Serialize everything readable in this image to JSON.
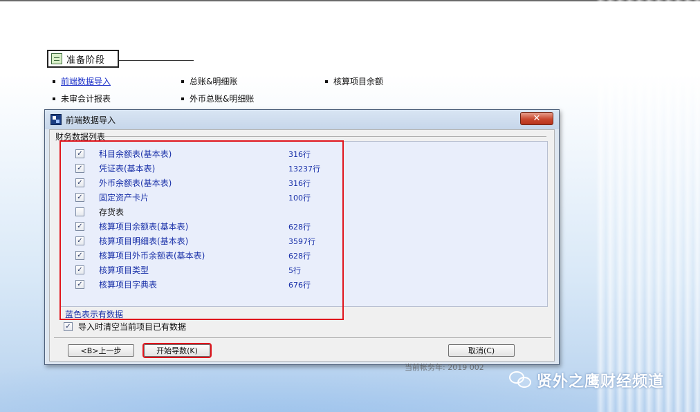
{
  "stage": {
    "title": "准备阶段"
  },
  "tasks": [
    {
      "label": "前端数据导入",
      "link": true
    },
    {
      "label": "总账&明细账",
      "link": false
    },
    {
      "label": "核算项目余额",
      "link": false
    },
    {
      "label": "未审会计报表",
      "link": false
    },
    {
      "label": "外币总账&明细账",
      "link": false
    }
  ],
  "dialog": {
    "title": "前端数据导入",
    "close_label": "✕",
    "group_label": "财务数据列表",
    "items": [
      {
        "name": "科目余额表(基本表)",
        "count": "316行",
        "checked": true
      },
      {
        "name": "凭证表(基本表)",
        "count": "13237行",
        "checked": true
      },
      {
        "name": "外币余额表(基本表)",
        "count": "316行",
        "checked": true
      },
      {
        "name": "固定资产卡片",
        "count": "100行",
        "checked": true
      },
      {
        "name": "存货表",
        "count": "",
        "checked": false
      },
      {
        "name": "核算项目余额表(基本表)",
        "count": "628行",
        "checked": true
      },
      {
        "name": "核算项目明细表(基本表)",
        "count": "3597行",
        "checked": true
      },
      {
        "name": "核算项目外币余额表(基本表)",
        "count": "628行",
        "checked": true
      },
      {
        "name": "核算项目类型",
        "count": "5行",
        "checked": true
      },
      {
        "name": "核算项目字典表",
        "count": "676行",
        "checked": true
      }
    ],
    "note": "蓝色表示有数据",
    "clear_option": {
      "label": "导入时清空当前项目已有数据",
      "checked": true
    },
    "buttons": {
      "prev": "<B>上一步",
      "start": "开始导数(K)",
      "cancel": "取消(C)"
    }
  },
  "behind_text": "当前帐务年: 2019 002",
  "watermark": {
    "text": "贤外之鹰财经频道"
  },
  "colors": {
    "link_blue": "#1a2fc8",
    "data_blue": "#1930a8",
    "highlight_red": "#e0141c",
    "close_red": "#c9482f"
  }
}
